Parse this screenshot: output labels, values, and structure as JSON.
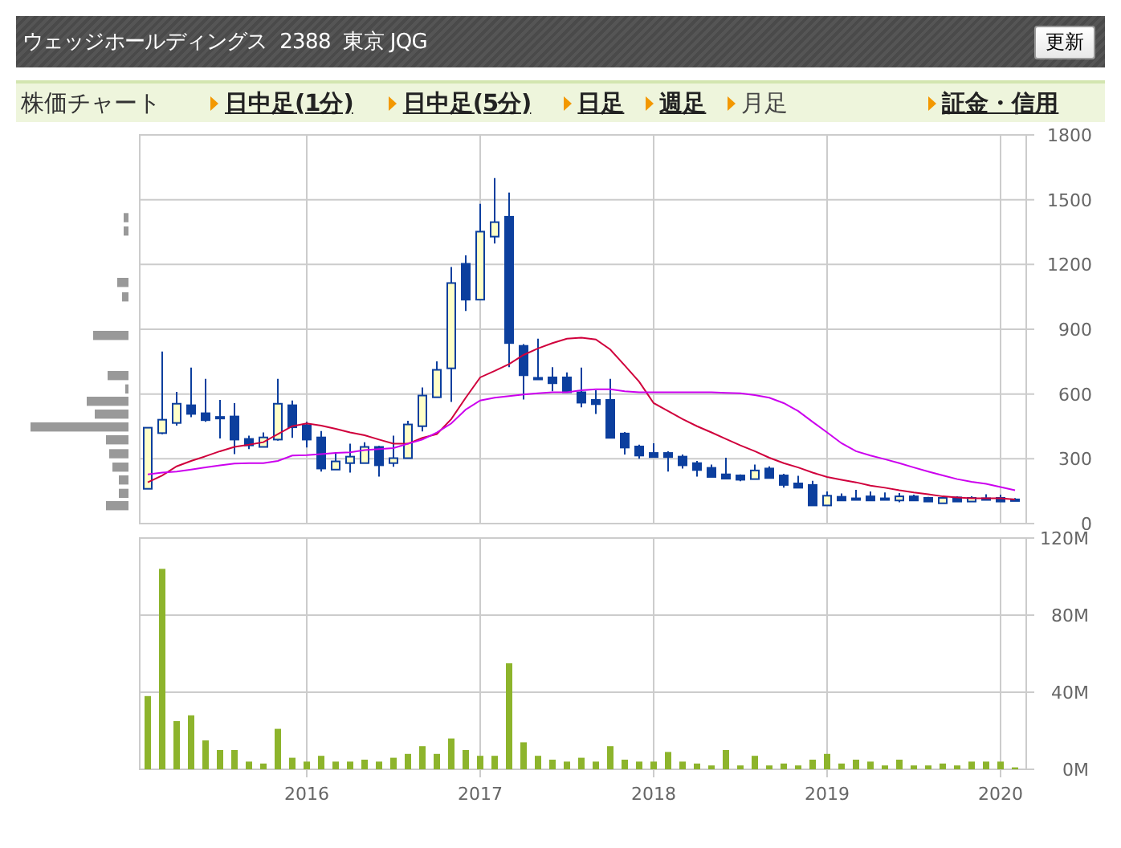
{
  "header": {
    "title": "ウェッジホールディングス  2388  東京 JQG",
    "button": "更新"
  },
  "nav": {
    "label": "株価チャート",
    "tabs": [
      {
        "label": "日中足(1分)",
        "selected": false
      },
      {
        "label": "日中足(5分)",
        "selected": false
      },
      {
        "label": "日足",
        "selected": false
      },
      {
        "label": "週足",
        "selected": false
      },
      {
        "label": "月足",
        "selected": true
      },
      {
        "label": "証金・信用",
        "selected": false
      }
    ]
  },
  "price_chart": {
    "chart_data": {
      "type": "candlestick",
      "categories": [
        null,
        null,
        null,
        null,
        null,
        null,
        null,
        null,
        null,
        null,
        null,
        null,
        null,
        null,
        null,
        null,
        null,
        null,
        null,
        null,
        null,
        null,
        null,
        null,
        null,
        null,
        null,
        null,
        null,
        null,
        null,
        null,
        null,
        null,
        null,
        null,
        null,
        null,
        null,
        null,
        null,
        null,
        null,
        null,
        null,
        null,
        null,
        null,
        null,
        null,
        null,
        null,
        null,
        null,
        null,
        null,
        null,
        null,
        null,
        null,
        null
      ],
      "ohlc": [
        [
          161,
          444,
          161,
          444
        ],
        [
          419,
          797,
          414,
          481
        ],
        [
          466,
          610,
          454,
          555
        ],
        [
          548,
          722,
          493,
          508
        ],
        [
          511,
          670,
          471,
          479
        ],
        [
          494,
          573,
          394,
          494
        ],
        [
          496,
          558,
          322,
          389
        ],
        [
          392,
          407,
          345,
          362
        ],
        [
          355,
          422,
          355,
          399
        ],
        [
          389,
          670,
          384,
          555
        ],
        [
          548,
          570,
          397,
          446
        ],
        [
          456,
          471,
          352,
          389
        ],
        [
          399,
          429,
          241,
          255
        ],
        [
          250,
          330,
          250,
          288
        ],
        [
          280,
          370,
          236,
          310
        ],
        [
          280,
          377,
          280,
          355
        ],
        [
          355,
          360,
          218,
          270
        ],
        [
          280,
          407,
          263,
          303
        ],
        [
          303,
          476,
          303,
          459
        ],
        [
          451,
          630,
          427,
          593
        ],
        [
          585,
          751,
          585,
          712
        ],
        [
          719,
          1188,
          563,
          1114
        ],
        [
          1203,
          1242,
          985,
          1037
        ],
        [
          1037,
          1481,
          1037,
          1352
        ],
        [
          1329,
          1600,
          1297,
          1396
        ],
        [
          1421,
          1533,
          724,
          836
        ],
        [
          823,
          831,
          575,
          687
        ],
        [
          675,
          856,
          667,
          675
        ],
        [
          677,
          724,
          613,
          650
        ],
        [
          677,
          700,
          608,
          608
        ],
        [
          608,
          722,
          538,
          560
        ],
        [
          573,
          617,
          508,
          553
        ],
        [
          573,
          670,
          397,
          397
        ],
        [
          417,
          424,
          320,
          352
        ],
        [
          357,
          365,
          300,
          315
        ],
        [
          327,
          372,
          308,
          308
        ],
        [
          327,
          335,
          241,
          308
        ],
        [
          310,
          320,
          255,
          270
        ],
        [
          280,
          290,
          218,
          248
        ],
        [
          258,
          273,
          216,
          216
        ],
        [
          228,
          305,
          208,
          208
        ],
        [
          223,
          228,
          196,
          203
        ],
        [
          206,
          273,
          206,
          246
        ],
        [
          255,
          265,
          211,
          211
        ],
        [
          223,
          231,
          166,
          179
        ],
        [
          186,
          221,
          166,
          166
        ],
        [
          179,
          198,
          84,
          84
        ],
        [
          84,
          149,
          84,
          129
        ],
        [
          124,
          139,
          107,
          107
        ],
        [
          117,
          156,
          110,
          117
        ],
        [
          126,
          149,
          107,
          107
        ],
        [
          117,
          144,
          110,
          117
        ],
        [
          107,
          141,
          99,
          126
        ],
        [
          126,
          134,
          104,
          107
        ],
        [
          119,
          124,
          100,
          102
        ],
        [
          94,
          126,
          94,
          119
        ],
        [
          121,
          126,
          100,
          102
        ],
        [
          102,
          126,
          102,
          119
        ],
        [
          117,
          136,
          108,
          117
        ],
        [
          119,
          134,
          100,
          102
        ],
        [
          112,
          118,
          106,
          112
        ]
      ],
      "ylim": [
        0,
        1800
      ],
      "yticks": [
        {
          "value": 0,
          "label": "0"
        },
        {
          "value": 300,
          "label": "300"
        },
        {
          "value": 600,
          "label": "600"
        },
        {
          "value": 900,
          "label": "900"
        },
        {
          "value": 1200,
          "label": "1200"
        },
        {
          "value": 1500,
          "label": "1500"
        },
        {
          "value": 1800,
          "label": "1800"
        }
      ],
      "grid": true
    }
  },
  "moving_averages": {
    "chart_data": {
      "type": "line",
      "categories": [
        null,
        null,
        null,
        null,
        null,
        null,
        null,
        null,
        null,
        null,
        null,
        null,
        null,
        null,
        null,
        null,
        null,
        null,
        null,
        null,
        null,
        null,
        null,
        null,
        null,
        null,
        null,
        null,
        null,
        null,
        null,
        null,
        null,
        null,
        null,
        null,
        null,
        null,
        null,
        null,
        null,
        null,
        null,
        null,
        null,
        null,
        null,
        null,
        null,
        null,
        null,
        null,
        null,
        null,
        null,
        null,
        null,
        null,
        null,
        null,
        null
      ],
      "series": [
        {
          "color": "#d0003c",
          "values": [
            191,
            223,
            265,
            290,
            312,
            335,
            355,
            365,
            377,
            414,
            451,
            464,
            454,
            439,
            422,
            409,
            389,
            370,
            370,
            397,
            414,
            484,
            583,
            677,
            707,
            739,
            781,
            811,
            836,
            856,
            861,
            853,
            806,
            732,
            657,
            558,
            521,
            484,
            451,
            422,
            392,
            362,
            335,
            305,
            280,
            260,
            236,
            216,
            203,
            191,
            176,
            166,
            154,
            144,
            136,
            126,
            121,
            117,
            117,
            117,
            112
          ]
        },
        {
          "color": "#cc00ee",
          "values": [
            228,
            236,
            241,
            250,
            260,
            270,
            278,
            280,
            280,
            290,
            315,
            317,
            322,
            327,
            330,
            340,
            345,
            350,
            370,
            389,
            422,
            464,
            528,
            570,
            583,
            590,
            598,
            603,
            608,
            608,
            617,
            622,
            622,
            613,
            608,
            608,
            608,
            608,
            608,
            608,
            605,
            603,
            595,
            583,
            558,
            521,
            471,
            422,
            372,
            335,
            315,
            298,
            280,
            260,
            241,
            223,
            206,
            193,
            184,
            169,
            154
          ]
        }
      ],
      "ylim": [
        0,
        1800
      ]
    }
  },
  "volume_chart": {
    "chart_data": {
      "type": "bar",
      "categories": [
        null,
        null,
        null,
        null,
        null,
        null,
        null,
        null,
        null,
        null,
        null,
        "2016",
        null,
        null,
        null,
        null,
        null,
        null,
        null,
        null,
        null,
        null,
        null,
        "2017",
        null,
        null,
        null,
        null,
        null,
        null,
        null,
        null,
        null,
        null,
        null,
        "2018",
        null,
        null,
        null,
        null,
        null,
        null,
        null,
        null,
        null,
        null,
        null,
        "2019",
        null,
        null,
        null,
        null,
        null,
        null,
        null,
        null,
        null,
        null,
        null,
        "2020",
        null
      ],
      "series": [
        {
          "color": "#8db42c",
          "values": [
            38,
            104,
            25,
            28,
            15,
            10,
            10,
            4,
            3,
            21,
            6,
            4,
            7,
            4,
            4,
            5,
            4,
            6,
            8,
            12,
            8,
            16,
            10,
            7,
            7,
            55,
            14,
            7,
            5,
            4,
            6,
            4,
            12,
            5,
            4,
            4,
            9,
            4,
            3,
            2,
            10,
            2,
            7,
            2,
            3,
            2,
            5,
            8,
            3,
            5,
            4,
            2,
            5,
            2,
            2,
            3,
            2,
            4,
            4,
            4,
            1
          ]
        }
      ],
      "ylim": [
        0,
        120
      ],
      "yticks": [
        {
          "value": 0,
          "label": "0M"
        },
        {
          "value": 40,
          "label": "40M"
        },
        {
          "value": 80,
          "label": "80M"
        },
        {
          "value": 120,
          "label": "120M"
        }
      ],
      "grid": true
    }
  }
}
